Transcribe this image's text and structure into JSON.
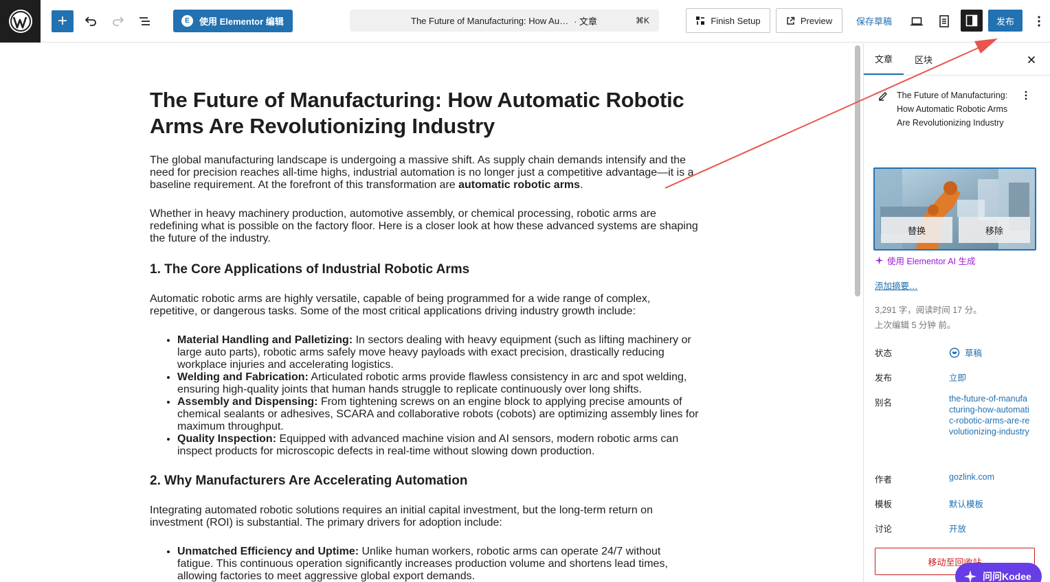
{
  "toolbar": {
    "elementor_label": "使用 Elementor 编辑",
    "doc_title": "The Future of Manufacturing: How Automatic Robotic Arms Are Revolutionizing Industry",
    "doc_type": "· 文章",
    "shortcut": "⌘K",
    "finish_setup": "Finish Setup",
    "preview": "Preview",
    "save_draft": "保存草稿",
    "publish": "发布"
  },
  "article": {
    "title": "The Future of Manufacturing: How Automatic Robotic Arms Are Revolutionizing Industry",
    "intro": "The global manufacturing landscape is undergoing a massive shift. As supply chain demands intensify and the need for precision reaches all-time highs, industrial automation is no longer just a competitive advantage—it is a baseline requirement. At the forefront of this transformation are ",
    "intro_bold": "automatic robotic arms",
    "intro_end": ".",
    "p2": "Whether in heavy machinery production, automotive assembly, or chemical processing, robotic arms are redefining what is possible on the factory floor. Here is a closer look at how these advanced systems are shaping the future of the industry.",
    "h2_1": "1. The Core Applications of Industrial Robotic Arms",
    "p3": "Automatic robotic arms are highly versatile, capable of being programmed for a wide range of complex, repetitive, or dangerous tasks. Some of the most critical applications driving industry growth include:",
    "list1": [
      {
        "bold": "Material Handling and Palletizing:",
        "text": " In sectors dealing with heavy equipment (such as lifting machinery or large auto parts), robotic arms safely move heavy payloads with exact precision, drastically reducing workplace injuries and accelerating logistics."
      },
      {
        "bold": "Welding and Fabrication:",
        "text": " Articulated robotic arms provide flawless consistency in arc and spot welding, ensuring high-quality joints that human hands struggle to replicate continuously over long shifts."
      },
      {
        "bold": "Assembly and Dispensing:",
        "text": " From tightening screws on an engine block to applying precise amounts of chemical sealants or adhesives, SCARA and collaborative robots (cobots) are optimizing assembly lines for maximum throughput."
      },
      {
        "bold": "Quality Inspection:",
        "text": " Equipped with advanced machine vision and AI sensors, modern robotic arms can inspect products for microscopic defects in real-time without slowing down production."
      }
    ],
    "h2_2": "2. Why Manufacturers Are Accelerating Automation",
    "p4": "Integrating automated robotic solutions requires an initial capital investment, but the long-term return on investment (ROI) is substantial. The primary drivers for adoption include:",
    "list2": [
      {
        "bold": "Unmatched Efficiency and Uptime:",
        "text": " Unlike human workers, robotic arms can operate 24/7 without fatigue. This continuous operation significantly increases production volume and shortens lead times, allowing factories to meet aggressive global export demands."
      }
    ]
  },
  "sidebar": {
    "tab_post": "文章",
    "tab_block": "区块",
    "post_title": "The Future of Manufacturing: How Automatic Robotic Arms Are Revolutionizing Industry",
    "replace": "替换",
    "remove": "移除",
    "ai_generate": "使用 Elementor AI 生成",
    "add_excerpt": "添加摘要…",
    "word_count": "3,291 字，阅读时间 17 分。",
    "last_edited": "上次编辑 5 分钟 前。",
    "rows": {
      "status_label": "状态",
      "status_value": "草稿",
      "publish_label": "发布",
      "publish_value": "立即",
      "slug_label": "别名",
      "slug_value": "the-future-of-manufacturing-how-automatic-robotic-arms-are-revolutionizing-industry",
      "author_label": "作者",
      "author_value": "gozlink.com",
      "template_label": "模板",
      "template_value": "默认模板",
      "discussion_label": "讨论",
      "discussion_value": "开放"
    },
    "trash": "移动至回收站"
  },
  "kodee": "问问Kodee",
  "colors": {
    "accent": "#2271b1",
    "ai": "#9b1bd8",
    "danger": "#cc1818",
    "kodee": "#673de6",
    "annotation_arrow": "#e8554e"
  }
}
